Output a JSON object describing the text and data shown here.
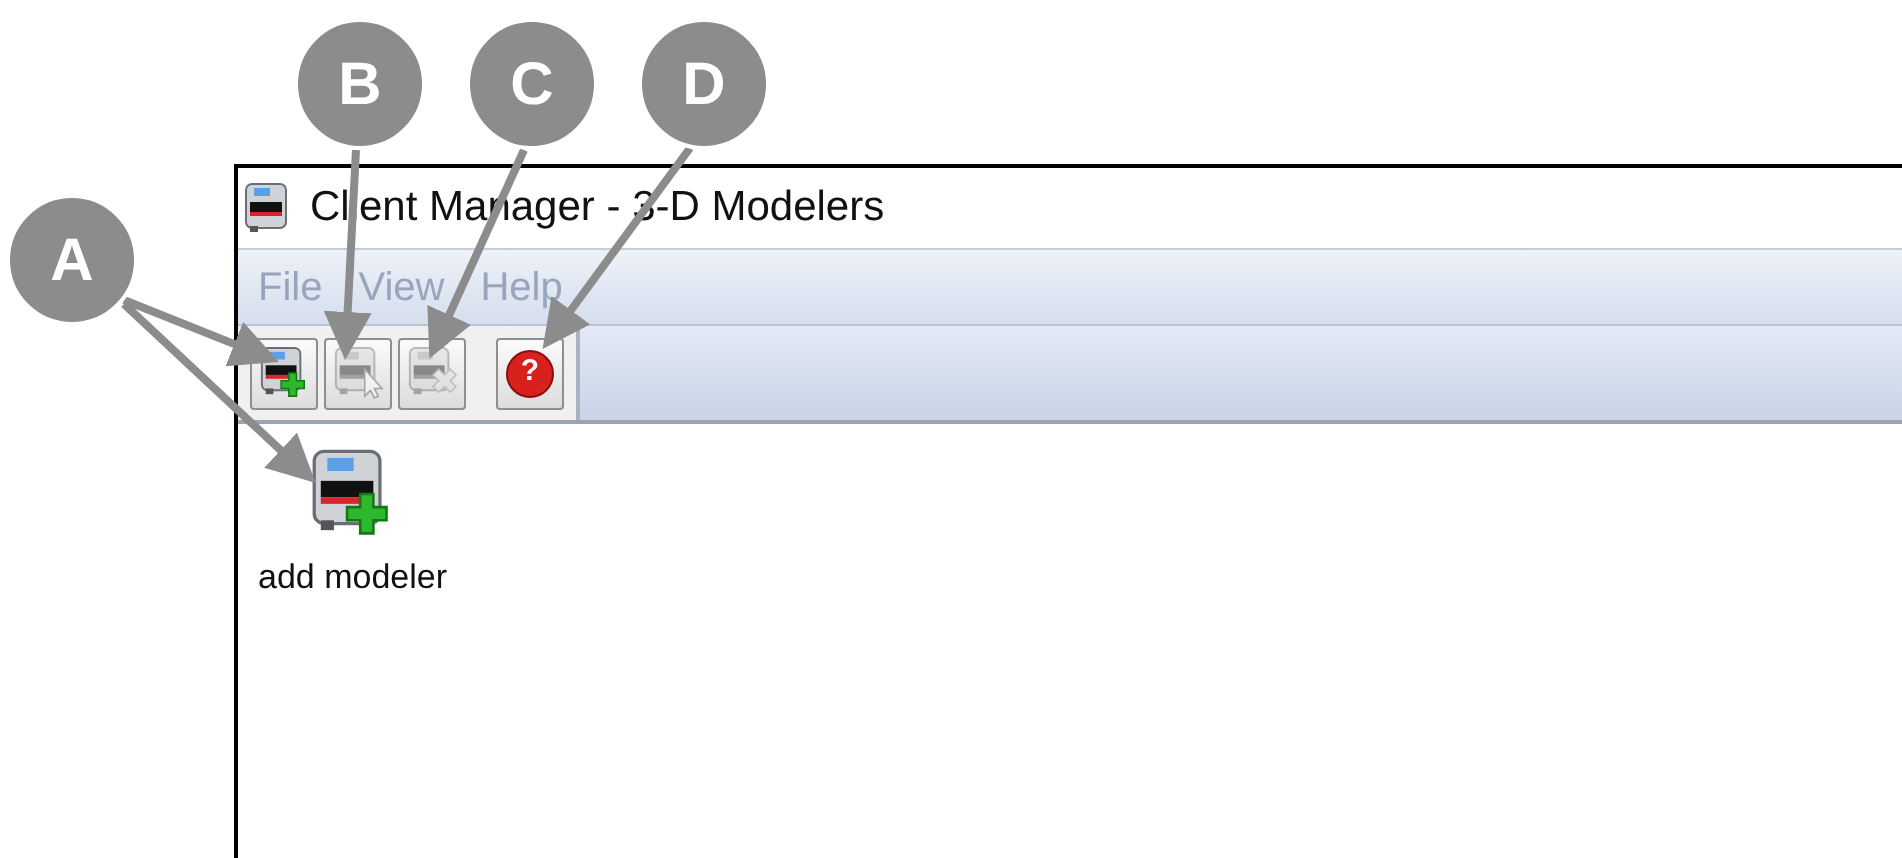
{
  "window": {
    "title": "Client Manager - 3-D Modelers"
  },
  "menu": [
    {
      "label": "File",
      "disabled": true
    },
    {
      "label": "View",
      "disabled": true
    },
    {
      "label": "Help",
      "disabled": true
    }
  ],
  "toolbar": [
    {
      "kind": "add",
      "disabled": false
    },
    {
      "kind": "select",
      "disabled": true
    },
    {
      "kind": "remove",
      "disabled": true
    },
    {
      "kind": "help",
      "disabled": false,
      "glyph": "?"
    }
  ],
  "content": {
    "items": [
      {
        "label": "add modeler"
      }
    ]
  },
  "callouts": [
    {
      "label": "A"
    },
    {
      "label": "B"
    },
    {
      "label": "C"
    },
    {
      "label": "D"
    }
  ]
}
